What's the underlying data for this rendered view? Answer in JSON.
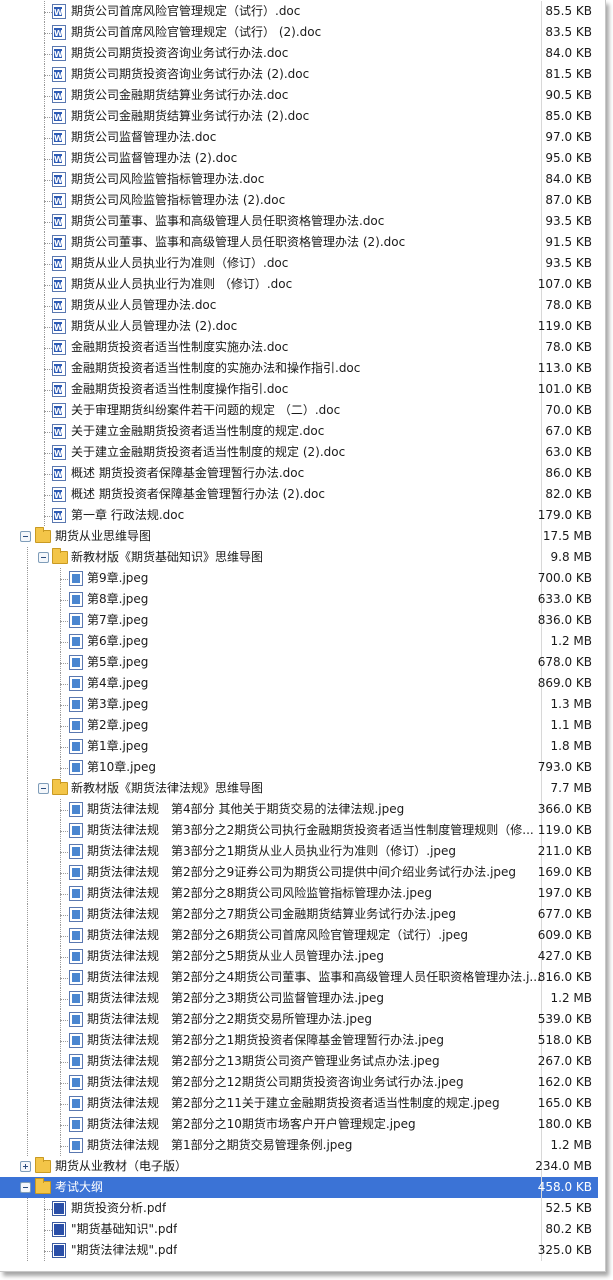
{
  "tree": {
    "rows": [
      {
        "name": "期货公司首席风险官管理规定（试行）.doc",
        "size": "85.5 KB",
        "type": "doc",
        "level": 3
      },
      {
        "name": "期货公司首席风险官管理规定（试行） (2).doc",
        "size": "83.5 KB",
        "type": "doc",
        "level": 3
      },
      {
        "name": "期货公司期货投资咨询业务试行办法.doc",
        "size": "84.0 KB",
        "type": "doc",
        "level": 3
      },
      {
        "name": "期货公司期货投资咨询业务试行办法 (2).doc",
        "size": "81.5 KB",
        "type": "doc",
        "level": 3
      },
      {
        "name": "期货公司金融期货结算业务试行办法.doc",
        "size": "90.5 KB",
        "type": "doc",
        "level": 3
      },
      {
        "name": "期货公司金融期货结算业务试行办法 (2).doc",
        "size": "85.0 KB",
        "type": "doc",
        "level": 3
      },
      {
        "name": "期货公司监督管理办法.doc",
        "size": "97.0 KB",
        "type": "doc",
        "level": 3
      },
      {
        "name": "期货公司监督管理办法 (2).doc",
        "size": "95.0 KB",
        "type": "doc",
        "level": 3
      },
      {
        "name": "期货公司风险监管指标管理办法.doc",
        "size": "84.0 KB",
        "type": "doc",
        "level": 3
      },
      {
        "name": "期货公司风险监管指标管理办法 (2).doc",
        "size": "87.0 KB",
        "type": "doc",
        "level": 3
      },
      {
        "name": "期货公司董事、监事和高级管理人员任职资格管理办法.doc",
        "size": "93.5 KB",
        "type": "doc",
        "level": 3
      },
      {
        "name": "期货公司董事、监事和高级管理人员任职资格管理办法 (2).doc",
        "size": "91.5 KB",
        "type": "doc",
        "level": 3
      },
      {
        "name": "期货从业人员执业行为准则（修订）.doc",
        "size": "93.5 KB",
        "type": "doc",
        "level": 3
      },
      {
        "name": "期货从业人员执业行为准则 （修订）.doc",
        "size": "107.0 KB",
        "type": "doc",
        "level": 3
      },
      {
        "name": "期货从业人员管理办法.doc",
        "size": "78.0 KB",
        "type": "doc",
        "level": 3
      },
      {
        "name": "期货从业人员管理办法 (2).doc",
        "size": "119.0 KB",
        "type": "doc",
        "level": 3
      },
      {
        "name": "金融期货投资者适当性制度实施办法.doc",
        "size": "78.0 KB",
        "type": "doc",
        "level": 3
      },
      {
        "name": "金融期货投资者适当性制度的实施办法和操作指引.doc",
        "size": "113.0 KB",
        "type": "doc",
        "level": 3
      },
      {
        "name": "金融期货投资者适当性制度操作指引.doc",
        "size": "101.0 KB",
        "type": "doc",
        "level": 3
      },
      {
        "name": "关于审理期货纠纷案件若干问题的规定 （二）.doc",
        "size": "70.0 KB",
        "type": "doc",
        "level": 3
      },
      {
        "name": "关于建立金融期货投资者适当性制度的规定.doc",
        "size": "67.0 KB",
        "type": "doc",
        "level": 3
      },
      {
        "name": "关于建立金融期货投资者适当性制度的规定 (2).doc",
        "size": "63.0 KB",
        "type": "doc",
        "level": 3
      },
      {
        "name": "概述 期货投资者保障基金管理暂行办法.doc",
        "size": "86.0 KB",
        "type": "doc",
        "level": 3
      },
      {
        "name": "概述 期货投资者保障基金管理暂行办法 (2).doc",
        "size": "82.0 KB",
        "type": "doc",
        "level": 3
      },
      {
        "name": "第一章 行政法规.doc",
        "size": "179.0 KB",
        "type": "doc",
        "level": 3
      },
      {
        "name": "期货从业思维导图",
        "size": "17.5 MB",
        "type": "folder",
        "level": 1,
        "expander": "minus"
      },
      {
        "name": "新教材版《期货基础知识》思维导图",
        "size": "9.8 MB",
        "type": "folder",
        "level": 2,
        "expander": "minus"
      },
      {
        "name": "第9章.jpeg",
        "size": "700.0 KB",
        "type": "img",
        "level": 4
      },
      {
        "name": "第8章.jpeg",
        "size": "633.0 KB",
        "type": "img",
        "level": 4
      },
      {
        "name": "第7章.jpeg",
        "size": "836.0 KB",
        "type": "img",
        "level": 4
      },
      {
        "name": "第6章.jpeg",
        "size": "1.2 MB",
        "type": "img",
        "level": 4
      },
      {
        "name": "第5章.jpeg",
        "size": "678.0 KB",
        "type": "img",
        "level": 4
      },
      {
        "name": "第4章.jpeg",
        "size": "869.0 KB",
        "type": "img",
        "level": 4
      },
      {
        "name": "第3章.jpeg",
        "size": "1.3 MB",
        "type": "img",
        "level": 4
      },
      {
        "name": "第2章.jpeg",
        "size": "1.1 MB",
        "type": "img",
        "level": 4
      },
      {
        "name": "第1章.jpeg",
        "size": "1.8 MB",
        "type": "img",
        "level": 4
      },
      {
        "name": "第10章.jpeg",
        "size": "793.0 KB",
        "type": "img",
        "level": 4
      },
      {
        "name": "新教材版《期货法律法规》思维导图",
        "size": "7.7 MB",
        "type": "folder",
        "level": 2,
        "expander": "minus"
      },
      {
        "name": "期货法律法规　第4部分 其他关于期货交易的法律法规.jpeg",
        "size": "366.0 KB",
        "type": "img",
        "level": 4
      },
      {
        "name": "期货法律法规　第3部分之2期货公司执行金融期货投资者适当性制度管理规则（修...",
        "size": "119.0 KB",
        "type": "img",
        "level": 4
      },
      {
        "name": "期货法律法规　第3部分之1期货从业人员执业行为准则（修订）.jpeg",
        "size": "211.0 KB",
        "type": "img",
        "level": 4
      },
      {
        "name": "期货法律法规　第2部分之9证券公司为期货公司提供中间介绍业务试行办法.jpeg",
        "size": "169.0 KB",
        "type": "img",
        "level": 4
      },
      {
        "name": "期货法律法规　第2部分之8期货公司风险监管指标管理办法.jpeg",
        "size": "197.0 KB",
        "type": "img",
        "level": 4
      },
      {
        "name": "期货法律法规　第2部分之7期货公司金融期货结算业务试行办法.jpeg",
        "size": "677.0 KB",
        "type": "img",
        "level": 4
      },
      {
        "name": "期货法律法规　第2部分之6期货公司首席风险官管理规定（试行）.jpeg",
        "size": "609.0 KB",
        "type": "img",
        "level": 4
      },
      {
        "name": "期货法律法规　第2部分之5期货从业人员管理办法.jpeg",
        "size": "427.0 KB",
        "type": "img",
        "level": 4
      },
      {
        "name": "期货法律法规　第2部分之4期货公司董事、监事和高级管理人员任职资格管理办法.j...",
        "size": "816.0 KB",
        "type": "img",
        "level": 4
      },
      {
        "name": "期货法律法规　第2部分之3期货公司监督管理办法.jpeg",
        "size": "1.2 MB",
        "type": "img",
        "level": 4
      },
      {
        "name": "期货法律法规　第2部分之2期货交易所管理办法.jpeg",
        "size": "539.0 KB",
        "type": "img",
        "level": 4
      },
      {
        "name": "期货法律法规　第2部分之1期货投资者保障基金管理暂行办法.jpeg",
        "size": "518.0 KB",
        "type": "img",
        "level": 4
      },
      {
        "name": "期货法律法规　第2部分之13期货公司资产管理业务试点办法.jpeg",
        "size": "267.0 KB",
        "type": "img",
        "level": 4
      },
      {
        "name": "期货法律法规　第2部分之12期货公司期货投资咨询业务试行办法.jpeg",
        "size": "162.0 KB",
        "type": "img",
        "level": 4
      },
      {
        "name": "期货法律法规　第2部分之11关于建立金融期货投资者适当性制度的规定.jpeg",
        "size": "165.0 KB",
        "type": "img",
        "level": 4
      },
      {
        "name": "期货法律法规　第2部分之10期货市场客户开户管理规定.jpeg",
        "size": "180.0 KB",
        "type": "img",
        "level": 4
      },
      {
        "name": "期货法律法规　第1部分之期货交易管理条例.jpeg",
        "size": "1.2 MB",
        "type": "img",
        "level": 4
      },
      {
        "name": "期货从业教材（电子版）",
        "size": "234.0 MB",
        "type": "folder",
        "level": 1,
        "expander": "plus"
      },
      {
        "name": "考试大纲",
        "size": "458.0 KB",
        "type": "folder",
        "level": 1,
        "expander": "minus",
        "selected": true
      },
      {
        "name": "期货投资分析.pdf",
        "size": "52.5 KB",
        "type": "pdf",
        "level": 2
      },
      {
        "name": "\"期货基础知识\".pdf",
        "size": "80.2 KB",
        "type": "pdf",
        "level": 2
      },
      {
        "name": "\"期货法律法规\".pdf",
        "size": "325.0 KB",
        "type": "pdf",
        "level": 2
      }
    ]
  },
  "colors": {
    "selected_bg": "#3b73d6",
    "folder": "#f3c548",
    "doc": "#2d5bb5"
  }
}
